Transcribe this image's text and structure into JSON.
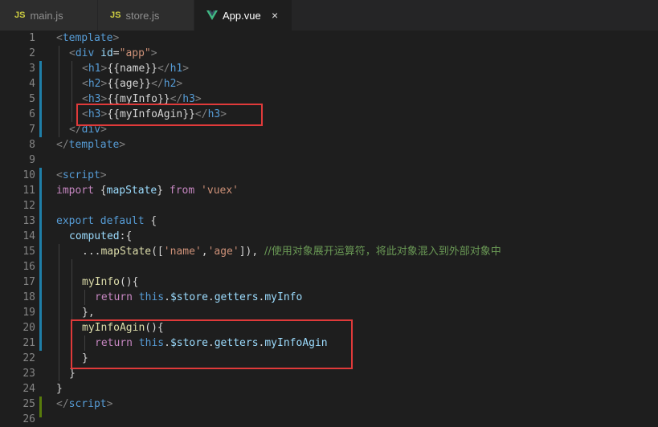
{
  "tabs": [
    {
      "icon": "JS",
      "label": "main.js",
      "active": false
    },
    {
      "icon": "JS",
      "label": "store.js",
      "active": false
    },
    {
      "icon": "vue-icon",
      "label": "App.vue",
      "active": true,
      "close": "×"
    }
  ],
  "colors": {
    "highlight_box": "#e03a3a",
    "modified_gutter": "#1f7fa8",
    "added_gutter": "#587c0c"
  },
  "lines": [
    {
      "n": "1"
    },
    {
      "n": "2"
    },
    {
      "n": "3"
    },
    {
      "n": "4"
    },
    {
      "n": "5"
    },
    {
      "n": "6"
    },
    {
      "n": "7"
    },
    {
      "n": "8"
    },
    {
      "n": "9"
    },
    {
      "n": "10"
    },
    {
      "n": "11"
    },
    {
      "n": "12"
    },
    {
      "n": "13"
    },
    {
      "n": "14"
    },
    {
      "n": "15"
    },
    {
      "n": "16"
    },
    {
      "n": "17"
    },
    {
      "n": "18"
    },
    {
      "n": "19"
    },
    {
      "n": "20"
    },
    {
      "n": "21"
    },
    {
      "n": "22"
    },
    {
      "n": "23"
    },
    {
      "n": "24"
    },
    {
      "n": "25"
    },
    {
      "n": "26"
    }
  ],
  "code": {
    "l1": {
      "a": "<",
      "b": "template",
      "c": ">"
    },
    "l2": {
      "a": "<",
      "b": "div",
      "c": " id",
      "d": "=",
      "e": "\"app\"",
      "f": ">"
    },
    "l3": {
      "a": "<",
      "b": "h1",
      "c": ">",
      "d": "{{",
      "e": "name",
      "f": "}}",
      "g": "</",
      "h": "h1",
      "i": ">"
    },
    "l4": {
      "a": "<",
      "b": "h2",
      "c": ">",
      "d": "{{",
      "e": "age",
      "f": "}}",
      "g": "</",
      "h": "h2",
      "i": ">"
    },
    "l5": {
      "a": "<",
      "b": "h3",
      "c": ">",
      "d": "{{",
      "e": "myInfo",
      "f": "}}",
      "g": "</",
      "h": "h3",
      "i": ">"
    },
    "l6": {
      "a": "<",
      "b": "h3",
      "c": ">",
      "d": "{{",
      "e": "myInfoAgin",
      "f": "}}",
      "g": "</",
      "h": "h3",
      "i": ">"
    },
    "l7": {
      "a": "</",
      "b": "div",
      "c": ">"
    },
    "l8": {
      "a": "</",
      "b": "template",
      "c": ">"
    },
    "l10": {
      "a": "<",
      "b": "script",
      "c": ">"
    },
    "l11": {
      "a": "import",
      "b": " {",
      "c": "mapState",
      "d": "} ",
      "e": "from",
      "f": " ",
      "g": "'vuex'"
    },
    "l13": {
      "a": "export",
      "b": " ",
      "c": "default",
      "d": " {"
    },
    "l14": {
      "a": "computed",
      "b": ":{"
    },
    "l15": {
      "a": "...",
      "b": "mapState",
      "c": "([",
      "d": "'name'",
      "e": ",",
      "f": "'age'",
      "g": "]), ",
      "h": "//使用对象展开运算符，将此对象混入到外部对象中"
    },
    "l17": {
      "a": "myInfo",
      "b": "(){"
    },
    "l18": {
      "a": "return",
      "b": " ",
      "c": "this",
      "d": ".",
      "e": "$store",
      "f": ".",
      "g": "getters",
      "h": ".",
      "i": "myInfo"
    },
    "l19": {
      "a": "},"
    },
    "l20": {
      "a": "myInfoAgin",
      "b": "(){"
    },
    "l21": {
      "a": "return",
      "b": " ",
      "c": "this",
      "d": ".",
      "e": "$store",
      "f": ".",
      "g": "getters",
      "h": ".",
      "i": "myInfoAgin"
    },
    "l22": {
      "a": "}"
    },
    "l23": {
      "a": "}"
    },
    "l24": {
      "a": "}"
    },
    "l25": {
      "a": "</",
      "b": "script",
      "c": ">"
    }
  }
}
